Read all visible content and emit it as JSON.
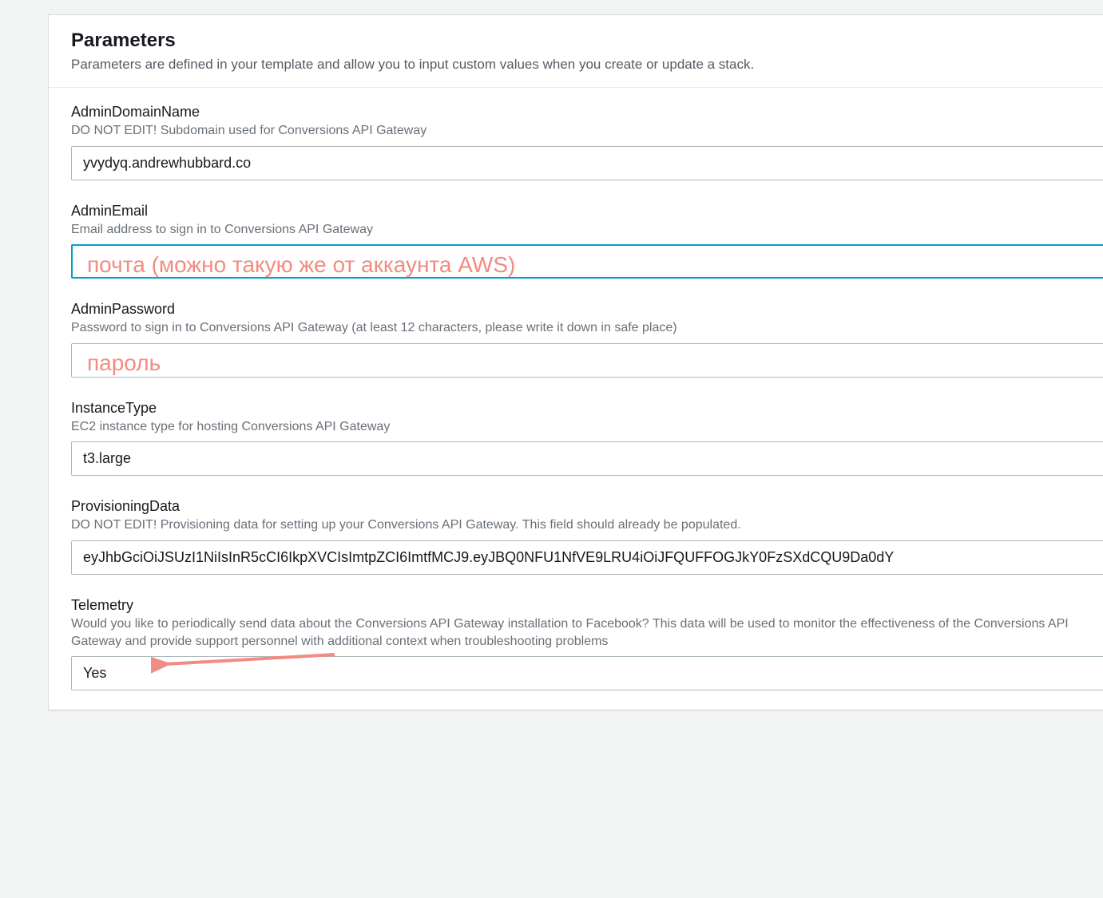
{
  "header": {
    "title": "Parameters",
    "subtitle": "Parameters are defined in your template and allow you to input custom values when you create or update a stack."
  },
  "fields": {
    "adminDomain": {
      "label": "AdminDomainName",
      "desc": "DO NOT EDIT! Subdomain used for Conversions API Gateway",
      "value": "yvydyq.andrewhubbard.co"
    },
    "adminEmail": {
      "label": "AdminEmail",
      "desc": "Email address to sign in to Conversions API Gateway",
      "value": "",
      "overlay": "почта (можно такую же от аккаунта AWS)"
    },
    "adminPassword": {
      "label": "AdminPassword",
      "desc": "Password to sign in to Conversions API Gateway (at least 12 characters, please write it down in safe place)",
      "value": "",
      "overlay": "пароль"
    },
    "instanceType": {
      "label": "InstanceType",
      "desc": "EC2 instance type for hosting Conversions API Gateway",
      "value": "t3.large"
    },
    "provisioningData": {
      "label": "ProvisioningData",
      "desc": "DO NOT EDIT! Provisioning data for setting up your Conversions API Gateway. This field should already be populated.",
      "value": "eyJhbGciOiJSUzI1NiIsInR5cCI6IkpXVCIsImtpZCI6ImtfMCJ9.eyJBQ0NFU1NfVE9LRU4iOiJFQUFFOGJkY0FzSXdCQU9Da0dY"
    },
    "telemetry": {
      "label": "Telemetry",
      "desc": "Would you like to periodically send data about the Conversions API Gateway installation to Facebook? This data will be used to monitor the effectiveness of the Conversions API Gateway and provide support personnel with additional context when troubleshooting problems",
      "value": "Yes"
    }
  },
  "colors": {
    "annotation": "#f28b82",
    "focus": "#00a1c9"
  }
}
